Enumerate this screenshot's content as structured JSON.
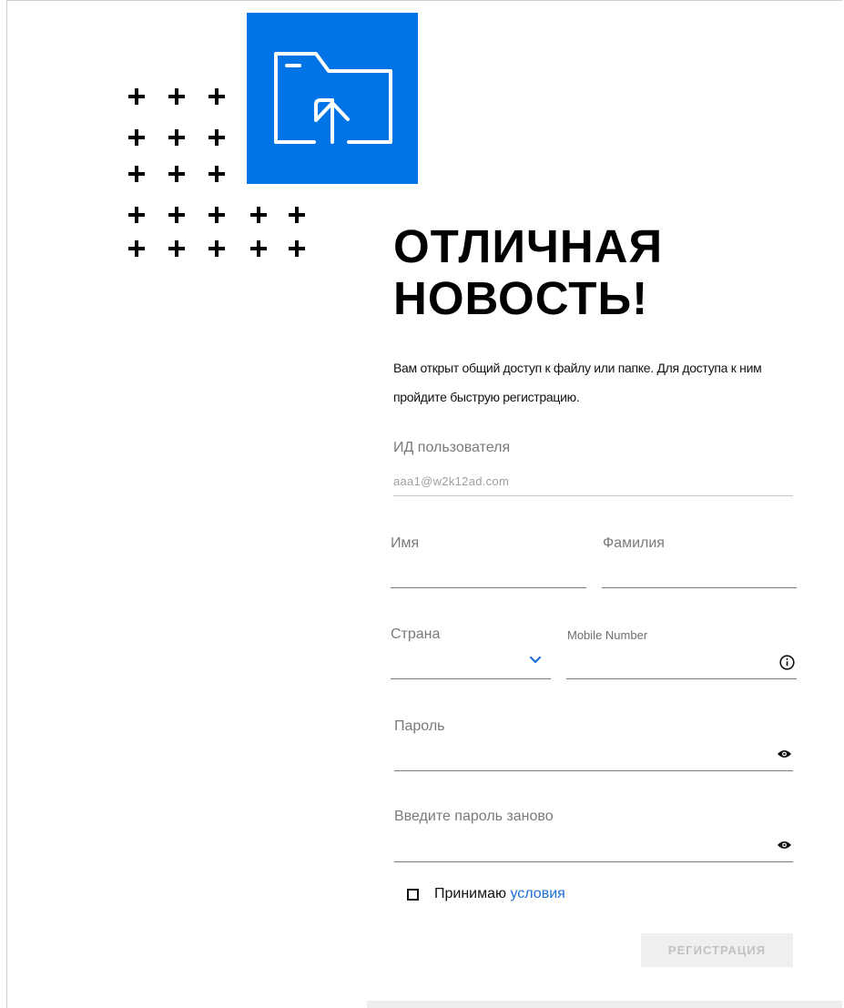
{
  "headline": {
    "line1": "ОТЛИЧНАЯ",
    "line2": "НОВОСТЬ!"
  },
  "intro": {
    "text": "Вам открыт общий доступ к файлу или папке. Для доступа к ним пройдите быструю регистрацию."
  },
  "form": {
    "user_id_label": "ИД пользователя",
    "user_id_value": "aaa1@w2k12ad.com",
    "first_name_label": "Имя",
    "last_name_label": "Фамилия",
    "country_label": "Страна",
    "mobile_label": "Mobile Number",
    "password_label": "Пароль",
    "password_repeat_label": "Введите пароль заново",
    "terms_text": "Принимаю",
    "terms_link": "условия",
    "register_button": "РЕГИСТРАЦИЯ"
  },
  "icons": {
    "folder_tile": "folder-upload-icon",
    "country_dropdown": "chevron-down-icon",
    "mobile_info": "info-icon",
    "password_visibility": "eye-icon",
    "password_repeat_visibility": "eye-icon"
  },
  "colors": {
    "brand_blue": "#0073e6",
    "link_blue": "#1a6fd6",
    "disabled_button_bg": "#efefef",
    "disabled_button_text": "#c2c2c2"
  }
}
